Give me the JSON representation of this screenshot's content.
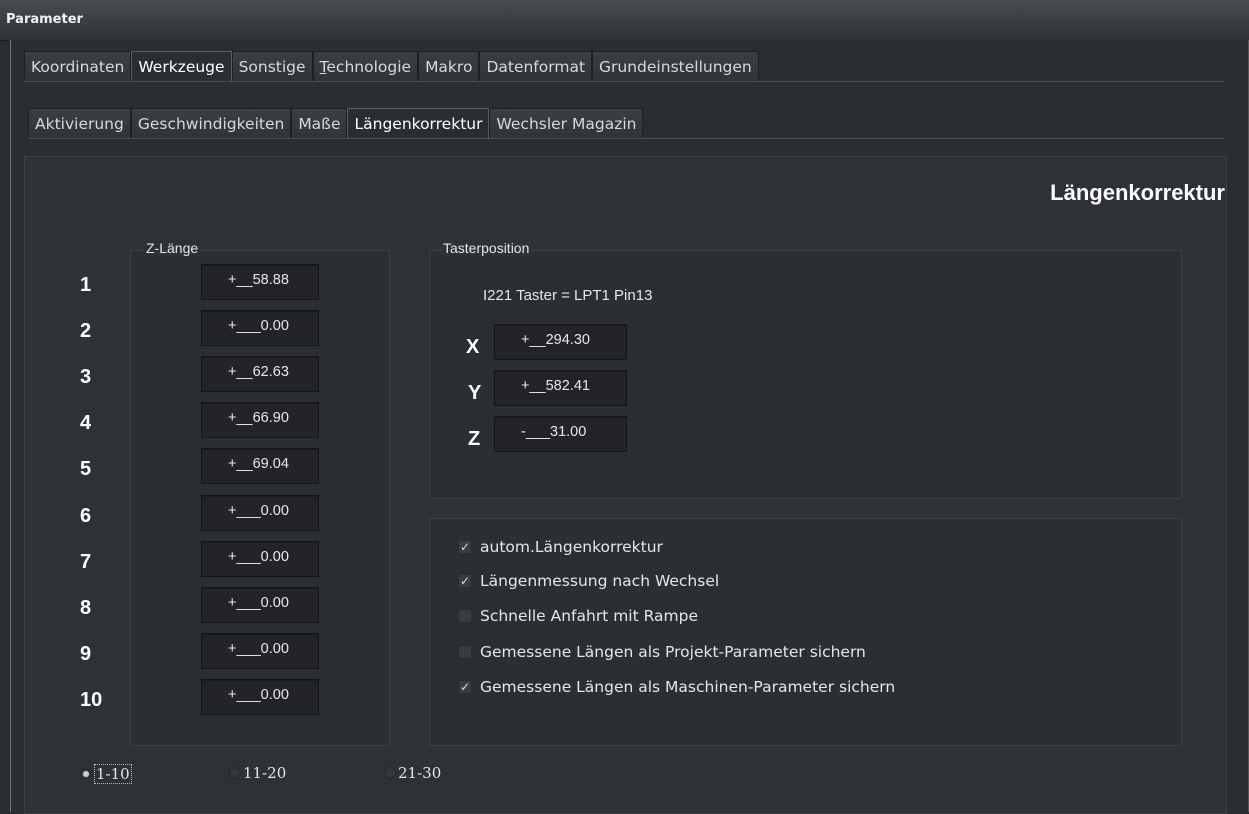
{
  "window": {
    "title": "Parameter"
  },
  "main_tabs": [
    {
      "label": "Koordinaten",
      "active": false
    },
    {
      "label": "Werkzeuge",
      "active": true
    },
    {
      "label": "Sonstige",
      "active": false
    },
    {
      "label": "Technologie",
      "active": false,
      "mnemonic": "T"
    },
    {
      "label": "Makro",
      "active": false
    },
    {
      "label": "Datenformat",
      "active": false
    },
    {
      "label": "Grundeinstellungen",
      "active": false
    }
  ],
  "sub_tabs": [
    {
      "label": "Aktivierung",
      "active": false
    },
    {
      "label": "Geschwindigkeiten",
      "active": false
    },
    {
      "label": "Maße",
      "active": false
    },
    {
      "label": "Längenkorrektur",
      "active": true
    },
    {
      "label": "Wechsler Magazin",
      "active": false
    }
  ],
  "page": {
    "heading": "Längenkorrektur"
  },
  "z_length": {
    "legend": "Z-Länge",
    "rows": [
      {
        "num": "1",
        "value": "+__58.88"
      },
      {
        "num": "2",
        "value": "+___0.00"
      },
      {
        "num": "3",
        "value": "+__62.63"
      },
      {
        "num": "4",
        "value": "+__66.90"
      },
      {
        "num": "5",
        "value": "+__69.04"
      },
      {
        "num": "6",
        "value": "+___0.00"
      },
      {
        "num": "7",
        "value": "+___0.00"
      },
      {
        "num": "8",
        "value": "+___0.00"
      },
      {
        "num": "9",
        "value": "+___0.00"
      },
      {
        "num": "10",
        "value": "+___0.00"
      }
    ]
  },
  "probe": {
    "legend": "Tasterposition",
    "info": "I221 Taster = LPT1 Pin13",
    "axes": [
      {
        "axis": "X",
        "value": "+__294.30"
      },
      {
        "axis": "Y",
        "value": "+__582.41"
      },
      {
        "axis": "Z",
        "value": "-___31.00"
      }
    ]
  },
  "options": [
    {
      "label": "autom.Längenkorrektur",
      "checked": true
    },
    {
      "label": "Längenmessung nach Wechsel",
      "checked": true
    },
    {
      "label": "Schnelle Anfahrt mit Rampe",
      "checked": false
    },
    {
      "label": "Gemessene Längen als Projekt-Parameter sichern",
      "checked": false
    },
    {
      "label": "Gemessene Längen als Maschinen-Parameter sichern",
      "checked": true
    }
  ],
  "ranges": [
    {
      "label": "1-10",
      "selected": true
    },
    {
      "label": "11-20",
      "selected": false
    },
    {
      "label": "21-30",
      "selected": false
    }
  ],
  "colors": {
    "background": "#2a2d30",
    "text": "#e6e6e6",
    "field_bg": "#222427"
  }
}
